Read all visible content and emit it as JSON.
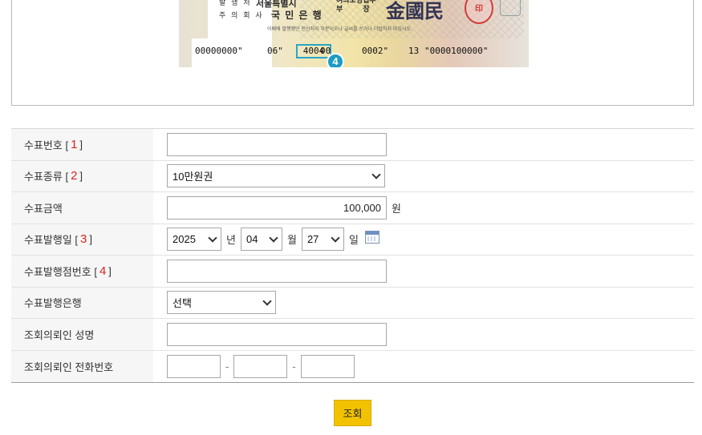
{
  "cheque_image": {
    "issuer_label": "발 행 처",
    "issuer_name": "서울특별시",
    "holder_label": "주 의 회 사",
    "bank_name": "국 민 은 행",
    "dept": "여의도영업부\n부        장",
    "signature": "金國民",
    "seal": "印",
    "fine_print": "이배에 발행했던 전산처리 부분이오나 글씨를 쓰거나 더럽히지 마십시오.",
    "micr": [
      "00000000\"",
      "06\"",
      "4004",
      "00",
      "0002\"",
      "13",
      "\"0000100000\""
    ],
    "badge": "4"
  },
  "form": {
    "rows": [
      {
        "label": "수표번호 [",
        "num": "1",
        "close": "]"
      },
      {
        "label": "수표종류 [",
        "num": "2",
        "close": "]"
      },
      {
        "label": "수표금액"
      },
      {
        "label": "수표발행일 [",
        "num": "3",
        "close": "]"
      },
      {
        "label": "수표발행점번호 [",
        "num": "4",
        "close": "]"
      },
      {
        "label": "수표발행은행"
      },
      {
        "label": "조회의뢰인 성명"
      },
      {
        "label": "조회의뢰인 전화번호"
      }
    ],
    "check_number": "",
    "check_type": "10만원권",
    "amount": "100,000",
    "amount_unit": "원",
    "issue_year": "2025",
    "year_unit": "년",
    "issue_month": "04",
    "month_unit": "월",
    "issue_day": "27",
    "day_unit": "일",
    "branch_number": "",
    "bank": "선택",
    "requester_name": "",
    "phone1": "",
    "phone2": "",
    "phone3": "",
    "dash": "-"
  },
  "submit_label": "조회",
  "icons": {
    "calendar": "calendar-icon",
    "dropdown": "chevron-down-icon"
  }
}
